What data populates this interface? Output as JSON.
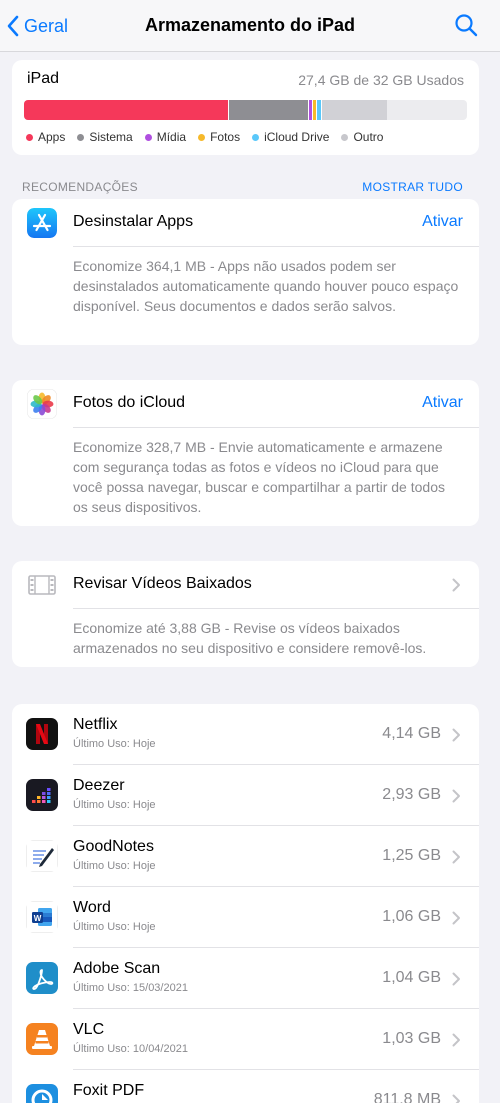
{
  "nav": {
    "back_label": "Geral",
    "title": "Armazenamento do iPad"
  },
  "storage": {
    "device": "iPad",
    "used_text": "27,4 GB de 32 GB Usados",
    "segments": [
      {
        "name": "Apps",
        "fraction": 0.46,
        "color": "#f5385a"
      },
      {
        "name": "Sistema",
        "fraction": 0.18,
        "color": "#8e8e93"
      },
      {
        "name": "Mídia",
        "fraction": 0.01,
        "color": "#b04fe0"
      },
      {
        "name": "Fotos",
        "fraction": 0.01,
        "color": "#f6b92b"
      },
      {
        "name": "iCloud Drive",
        "fraction": 0.01,
        "color": "#5ac8fa"
      },
      {
        "name": "Outro",
        "fraction": 0.15,
        "color": "#d1d1d6"
      }
    ],
    "legend": [
      {
        "label": "Apps",
        "color": "#f5385a"
      },
      {
        "label": "Sistema",
        "color": "#8e8e93"
      },
      {
        "label": "Mídia",
        "color": "#b04fe0"
      },
      {
        "label": "Fotos",
        "color": "#f6b92b"
      },
      {
        "label": "iCloud Drive",
        "color": "#5ac8fa"
      },
      {
        "label": "Outro",
        "color": "#c7c7cc"
      }
    ]
  },
  "recommendations": {
    "header": "RECOMENDAÇÕES",
    "show_all": "MOSTRAR TUDO",
    "items": [
      {
        "title": "Desinstalar Apps",
        "action": "Ativar",
        "icon": "app-store-icon",
        "desc": "Economize 364,1 MB - Apps não usados podem ser desinstalados automaticamente quando houver pouco espaço disponível. Seus documentos e dados serão salvos."
      },
      {
        "title": "Fotos do iCloud",
        "action": "Ativar",
        "icon": "photos-icon",
        "desc": "Economize 328,7 MB - Envie automaticamente e armazene com segurança todas as fotos e vídeos no iCloud para que você possa navegar, buscar e compartilhar a partir de todos os seus dispositivos."
      },
      {
        "title": "Revisar Vídeos Baixados",
        "icon": "film-icon",
        "desc": "Economize até 3,88 GB - Revise os vídeos baixados armazenados no seu dispositivo e considere removê-los."
      }
    ]
  },
  "apps": [
    {
      "name": "Netflix",
      "last": "Último Uso: Hoje",
      "size": "4,14 GB",
      "icon": "netflix-icon"
    },
    {
      "name": "Deezer",
      "last": "Último Uso: Hoje",
      "size": "2,93 GB",
      "icon": "deezer-icon"
    },
    {
      "name": "GoodNotes",
      "last": "Último Uso: Hoje",
      "size": "1,25 GB",
      "icon": "goodnotes-icon"
    },
    {
      "name": "Word",
      "last": "Último Uso: Hoje",
      "size": "1,06 GB",
      "icon": "word-icon"
    },
    {
      "name": "Adobe Scan",
      "last": "Último Uso: 15/03/2021",
      "size": "1,04 GB",
      "icon": "adobe-scan-icon"
    },
    {
      "name": "VLC",
      "last": "Último Uso: 10/04/2021",
      "size": "1,03 GB",
      "icon": "vlc-icon"
    },
    {
      "name": "Foxit PDF",
      "last": "",
      "size": "811,8 MB",
      "icon": "foxit-pdf-icon"
    }
  ]
}
